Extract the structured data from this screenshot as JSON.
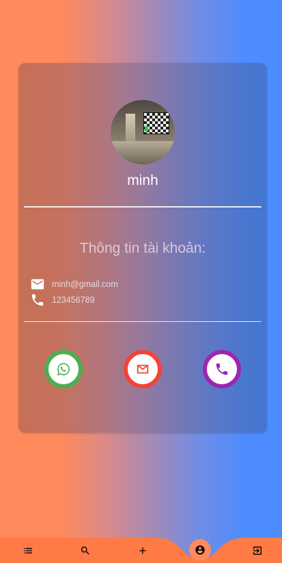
{
  "profile": {
    "name": "minh"
  },
  "info": {
    "title": "Thông tin tài khoản:",
    "email": "minh@gmail.com",
    "phone": "123456789"
  },
  "actions": [
    {
      "icon": "whatsapp-icon",
      "color": "#4caf50"
    },
    {
      "icon": "mail-icon",
      "color": "#f44336"
    },
    {
      "icon": "phone-icon",
      "color": "#9c27b0"
    }
  ],
  "nav": {
    "bar_color": "#ff7a45",
    "items": [
      {
        "icon": "list-icon"
      },
      {
        "icon": "search-icon"
      },
      {
        "icon": "add-icon"
      },
      {
        "icon": "account-circle-icon",
        "active": true
      },
      {
        "icon": "logout-icon"
      }
    ]
  },
  "colors": {
    "bg_left": "#ff8a5c",
    "bg_right": "#4d8cff"
  }
}
